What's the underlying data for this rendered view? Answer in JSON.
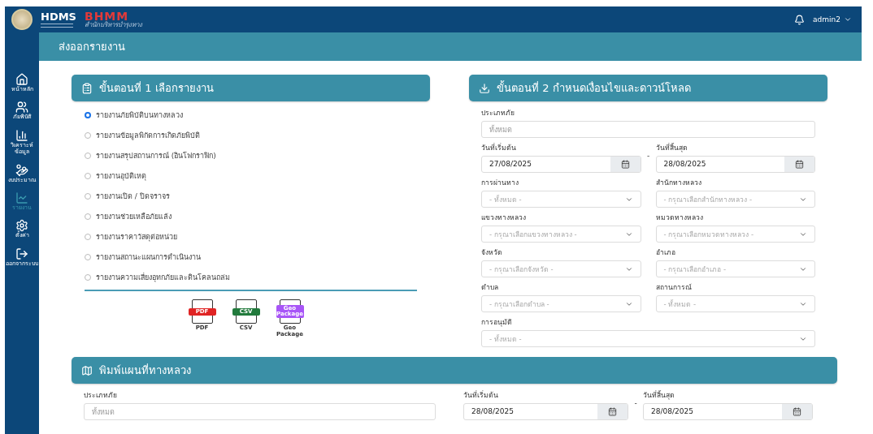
{
  "header": {
    "logo_title": "HDMS",
    "brand": "BHMM",
    "brand_subtitle": "สำนักบริหารบำรุงทาง",
    "user": "admin2"
  },
  "sidebar": {
    "items": [
      {
        "label": "หน้าหลัก",
        "selected": false
      },
      {
        "label": "ภัยพิบัติ",
        "selected": false
      },
      {
        "label": "วิเคราะห์ข้อมูล",
        "selected": false
      },
      {
        "label": "งบประมาณ",
        "selected": false
      },
      {
        "label": "รายงาน",
        "selected": true
      },
      {
        "label": "ตั้งค่า",
        "selected": false
      },
      {
        "label": "ออกจากระบบ",
        "selected": false
      }
    ]
  },
  "page_title": "ส่งออกรายงาน",
  "step1": {
    "title": "ขั้นตอนที่ 1 เลือกรายงาน",
    "reports": [
      {
        "label": "รายงานภัยพิบัติบนทางหลวง",
        "selected": true
      },
      {
        "label": "รายงานข้อมูลพิกัดการเกิดภัยพิบัติ",
        "selected": false
      },
      {
        "label": "รายงานสรุปสถานการณ์ (อินโฟกราฟิก)",
        "selected": false
      },
      {
        "label": "รายงานอุบัติเหตุ",
        "selected": false
      },
      {
        "label": "รายงานเปิด / ปิดจราจร",
        "selected": false
      },
      {
        "label": "รายงานช่วยเหลือภัยแล้ง",
        "selected": false
      },
      {
        "label": "รายงานราคาวัสดุต่อหน่วย",
        "selected": false
      },
      {
        "label": "รายงานสถานะแผนการดำเนินงาน",
        "selected": false
      },
      {
        "label": "รายงานความเสี่ยงอุทกภัยและดินโคลนถล่ม",
        "selected": false
      }
    ],
    "formats": [
      {
        "badge": "PDF",
        "caption": "PDF",
        "color": "#e02424"
      },
      {
        "badge": "CSV",
        "caption": "CSV",
        "color": "#217a3c"
      },
      {
        "badge": "Geo Package",
        "caption": "Geo Package",
        "color": "#a855f7"
      }
    ]
  },
  "step2": {
    "title": "ขั้นตอนที่ 2 กำหนดเงื่อนไขและดาวน์โหลด",
    "rows": [
      {
        "fields": [
          {
            "kind": "text",
            "label": "ประเภทภัย",
            "placeholder": "ทั้งหมด"
          }
        ]
      },
      {
        "separator": "-",
        "fields": [
          {
            "kind": "date",
            "label": "วันที่เริ่มต้น",
            "value": "27/08/2025"
          },
          {
            "kind": "date",
            "label": "วันที่สิ้นสุด",
            "value": "28/08/2025"
          }
        ]
      },
      {
        "fields": [
          {
            "kind": "select",
            "label": "การผ่านทาง",
            "placeholder": "- ทั้งหมด -"
          },
          {
            "kind": "select",
            "label": "สำนักทางหลวง",
            "placeholder": "- กรุณาเลือกสำนักทางหลวง -"
          }
        ]
      },
      {
        "fields": [
          {
            "kind": "select",
            "label": "แขวงทางหลวง",
            "placeholder": "- กรุณาเลือกแขวงทางหลวง -"
          },
          {
            "kind": "select",
            "label": "หมวดทางหลวง",
            "placeholder": "- กรุณาเลือกหมวดทางหลวง -"
          }
        ]
      },
      {
        "fields": [
          {
            "kind": "select",
            "label": "จังหวัด",
            "placeholder": "- กรุณาเลือกจังหวัด -"
          },
          {
            "kind": "select",
            "label": "อำเภอ",
            "placeholder": "- กรุณาเลือกอำเภอ -"
          }
        ]
      },
      {
        "fields": [
          {
            "kind": "select",
            "label": "ตำบล",
            "placeholder": "- กรุณาเลือกตำบล -"
          },
          {
            "kind": "select",
            "label": "สถานการณ์",
            "placeholder": "- ทั้งหมด -"
          }
        ]
      },
      {
        "fields": [
          {
            "kind": "select",
            "label": "การอนุมัติ",
            "placeholder": "- ทั้งหมด -"
          }
        ]
      }
    ]
  },
  "map_print": {
    "title": "พิมพ์แผนที่ทางหลวง",
    "separator": "-",
    "fields": [
      {
        "kind": "text",
        "label": "ประเภทภัย",
        "placeholder": "ทั้งหมด"
      },
      {
        "kind": "date",
        "label": "วันที่เริ่มต้น",
        "value": "28/08/2025"
      },
      {
        "kind": "date",
        "label": "วันที่สิ้นสุด",
        "value": "28/08/2025"
      }
    ]
  }
}
